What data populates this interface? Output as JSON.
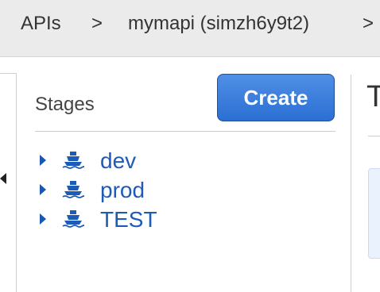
{
  "breadcrumb": {
    "items": [
      "APIs",
      ">",
      "mymapi (simzh6y9t2)",
      ">"
    ]
  },
  "stages_panel": {
    "title": "Stages",
    "create_label": "Create",
    "stages": [
      {
        "label": "dev"
      },
      {
        "label": "prod"
      },
      {
        "label": "TEST"
      }
    ]
  },
  "detail_panel": {
    "heading_partial": "T"
  },
  "colors": {
    "link": "#1d5bb8",
    "button": "#2c6fd3",
    "breadcrumb_bg": "#ebebeb"
  },
  "icons": {
    "stage": "ship-icon",
    "expand": "caret-right-icon",
    "collapse": "caret-left-icon"
  }
}
